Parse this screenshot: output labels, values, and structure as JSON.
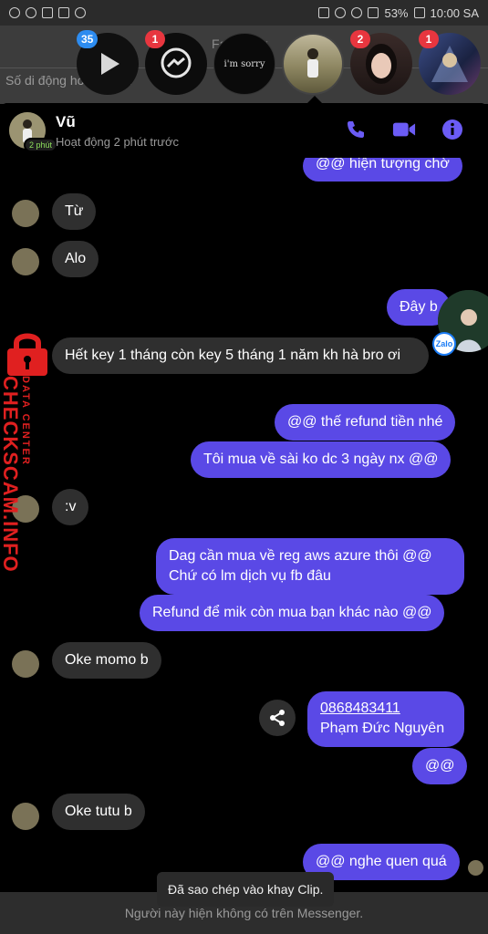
{
  "status_bar": {
    "battery": "53%",
    "time": "10:00 SA"
  },
  "background_screen": {
    "title": "Facebook",
    "phone_placeholder": "Số di động hoặc email"
  },
  "chat_heads": [
    {
      "name": "play-app",
      "badge": "35",
      "badge_color": "#2d8cf0"
    },
    {
      "name": "messenger",
      "badge": "1",
      "badge_color": "#e8363f"
    },
    {
      "name": "im-sorry",
      "text": "i'm sorry",
      "badge": ""
    },
    {
      "name": "vu",
      "badge": ""
    },
    {
      "name": "girl",
      "badge": "2",
      "badge_color": "#e8363f"
    },
    {
      "name": "game-art",
      "badge": "1",
      "badge_color": "#e8363f"
    }
  ],
  "chat": {
    "name": "Vũ",
    "status": "Hoạt động 2 phút trước",
    "active_badge": "2 phút"
  },
  "messages": [
    {
      "side": "out",
      "text": "@@ hiện tượng chờ"
    },
    {
      "side": "in",
      "text": "Từ"
    },
    {
      "side": "in",
      "text": "Alo"
    },
    {
      "side": "out",
      "text": "Đây b"
    },
    {
      "side": "in",
      "text": "Hết key 1 tháng còn key 5 tháng 1 năm kh hà bro ơi"
    },
    {
      "side": "out",
      "text": "@@ thế refund tiền nhé"
    },
    {
      "side": "out",
      "text": "Tôi mua về sài ko dc 3 ngày nx @@"
    },
    {
      "side": "in",
      "text": ":v"
    },
    {
      "side": "out",
      "text": "Dag cần mua về reg aws azure thôi  @@ Chứ có lm dịch vụ fb đâu"
    },
    {
      "side": "out",
      "text": "Refund để mik còn mua bạn khác nào @@"
    },
    {
      "side": "in",
      "text": "Oke momo b"
    },
    {
      "side": "out",
      "link": "0868483411",
      "text": "Phạm Đức Nguyên"
    },
    {
      "side": "out",
      "text": "@@"
    },
    {
      "side": "in",
      "text": "Oke tutu b"
    },
    {
      "side": "out",
      "text": "@@ nghe quen quá"
    }
  ],
  "zalo_label": "Zalo",
  "toast": "Đã sao chép vào khay Clip.",
  "bottom_notice": "Người này hiện không có trên Messenger.",
  "watermark": {
    "sub": "DATA CENTER",
    "main": "CHECKSCAM.INFO"
  },
  "colors": {
    "accent": "#5a49e6",
    "incoming": "#2f2f2f",
    "icon": "#6b5cf5",
    "watermark": "#e02020"
  }
}
